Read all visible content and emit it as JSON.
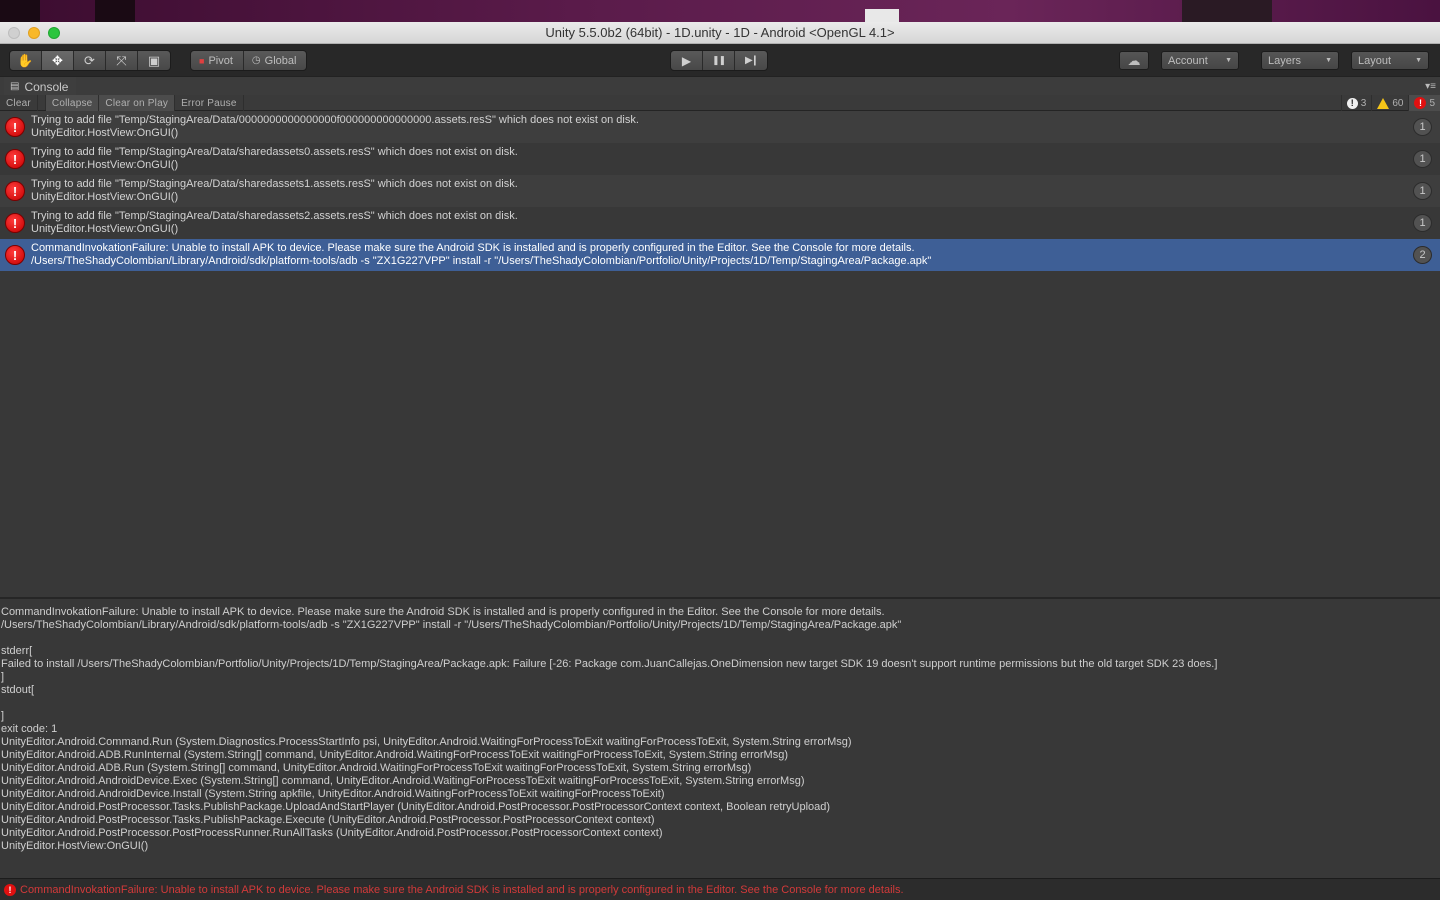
{
  "window": {
    "title": "Unity 5.5.0b2 (64bit) - 1D.unity - 1D - Android <OpenGL 4.1>"
  },
  "toolbar": {
    "transform_tools": [
      {
        "name": "hand-tool",
        "icon": "hand-icon",
        "glyph": "✋",
        "active": false
      },
      {
        "name": "move-tool",
        "icon": "move-icon",
        "glyph": "✥",
        "active": true
      },
      {
        "name": "rotate-tool",
        "icon": "rotate-icon",
        "glyph": "⟳",
        "active": false
      },
      {
        "name": "scale-tool",
        "icon": "scale-icon",
        "glyph": "⤧",
        "active": false
      },
      {
        "name": "rect-tool",
        "icon": "rect-icon",
        "glyph": "▣",
        "active": false
      }
    ],
    "pivot_label": "Pivot",
    "global_label": "Global",
    "play_glyph": "▶",
    "pause_glyph": "❚❚",
    "step_glyph": "▶❙",
    "cloud_glyph": "☁",
    "account_label": "Account",
    "layers_label": "Layers",
    "layout_label": "Layout",
    "caret_glyph": "▼"
  },
  "panel": {
    "tab_label": "Console",
    "menu_glyph": "▾≡"
  },
  "console_toolbar": {
    "clear": "Clear",
    "collapse": "Collapse",
    "clear_on_play": "Clear on Play",
    "error_pause": "Error Pause",
    "info_count": "3",
    "warning_count": "60",
    "error_count": "5"
  },
  "logs": [
    {
      "line1": "Trying to add file \"Temp/StagingArea/Data/0000000000000000f000000000000000.assets.resS\" which does not exist on disk.",
      "line2": "UnityEditor.HostView:OnGUI()",
      "count": "1",
      "selected": false
    },
    {
      "line1": "Trying to add file \"Temp/StagingArea/Data/sharedassets0.assets.resS\" which does not exist on disk.",
      "line2": "UnityEditor.HostView:OnGUI()",
      "count": "1",
      "selected": false
    },
    {
      "line1": "Trying to add file \"Temp/StagingArea/Data/sharedassets1.assets.resS\" which does not exist on disk.",
      "line2": "UnityEditor.HostView:OnGUI()",
      "count": "1",
      "selected": false
    },
    {
      "line1": "Trying to add file \"Temp/StagingArea/Data/sharedassets2.assets.resS\" which does not exist on disk.",
      "line2": "UnityEditor.HostView:OnGUI()",
      "count": "1",
      "selected": false
    },
    {
      "line1": "CommandInvokationFailure: Unable to install APK to device. Please make sure the Android SDK is installed and is properly configured in the Editor. See the Console for more details.",
      "line2": "/Users/TheShadyColombian/Library/Android/sdk/platform-tools/adb -s \"ZX1G227VPP\" install -r \"/Users/TheShadyColombian/Portfolio/Unity/Projects/1D/Temp/StagingArea/Package.apk\"",
      "count": "2",
      "selected": true
    }
  ],
  "detail": {
    "lines": [
      "CommandInvokationFailure: Unable to install APK to device. Please make sure the Android SDK is installed and is properly configured in the Editor. See the Console for more details.",
      "/Users/TheShadyColombian/Library/Android/sdk/platform-tools/adb -s \"ZX1G227VPP\" install -r \"/Users/TheShadyColombian/Portfolio/Unity/Projects/1D/Temp/StagingArea/Package.apk\"",
      "",
      "stderr[",
      "Failed to install /Users/TheShadyColombian/Portfolio/Unity/Projects/1D/Temp/StagingArea/Package.apk: Failure [-26: Package com.JuanCallejas.OneDimension new target SDK 19 doesn't support runtime permissions but the old target SDK 23 does.]",
      "]",
      "stdout[",
      "",
      "]",
      "exit code: 1",
      "UnityEditor.Android.Command.Run (System.Diagnostics.ProcessStartInfo psi, UnityEditor.Android.WaitingForProcessToExit waitingForProcessToExit, System.String errorMsg)",
      "UnityEditor.Android.ADB.RunInternal (System.String[] command, UnityEditor.Android.WaitingForProcessToExit waitingForProcessToExit, System.String errorMsg)",
      "UnityEditor.Android.ADB.Run (System.String[] command, UnityEditor.Android.WaitingForProcessToExit waitingForProcessToExit, System.String errorMsg)",
      "UnityEditor.Android.AndroidDevice.Exec (System.String[] command, UnityEditor.Android.WaitingForProcessToExit waitingForProcessToExit, System.String errorMsg)",
      "UnityEditor.Android.AndroidDevice.Install (System.String apkfile, UnityEditor.Android.WaitingForProcessToExit waitingForProcessToExit)",
      "UnityEditor.Android.PostProcessor.Tasks.PublishPackage.UploadAndStartPlayer (UnityEditor.Android.PostProcessor.PostProcessorContext context, Boolean retryUpload)",
      "UnityEditor.Android.PostProcessor.Tasks.PublishPackage.Execute (UnityEditor.Android.PostProcessor.PostProcessorContext context)",
      "UnityEditor.Android.PostProcessor.PostProcessRunner.RunAllTasks (UnityEditor.Android.PostProcessor.PostProcessorContext context)",
      "UnityEditor.HostView:OnGUI()"
    ]
  },
  "statusbar": {
    "message": "CommandInvokationFailure: Unable to install APK to device. Please make sure the Android SDK is installed and is properly configured in the Editor. See the Console for more details."
  },
  "colors": {
    "selection": "#3e5f96",
    "error": "#e01010",
    "status_error_text": "#d23a3a",
    "warning": "#f5c518"
  }
}
